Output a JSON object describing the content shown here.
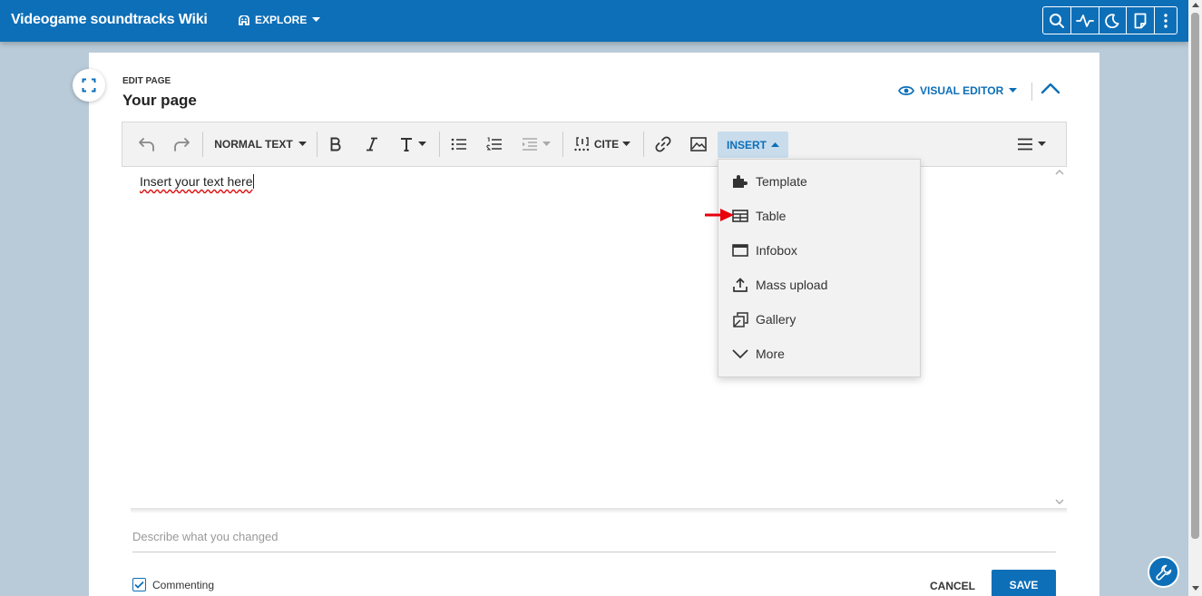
{
  "header": {
    "site_title": "Videogame soundtracks Wiki",
    "explore_label": "EXPLORE",
    "tools": [
      "search-icon",
      "activity-icon",
      "moon-icon",
      "discussion-icon",
      "more-icon"
    ]
  },
  "editor": {
    "edit_label": "EDIT PAGE",
    "page_title": "Your page",
    "mode_label": "VISUAL EDITOR",
    "content_text": "Insert your text here"
  },
  "toolbar": {
    "format_label": "NORMAL TEXT",
    "cite_label": "CITE",
    "insert_label": "INSERT"
  },
  "insert_menu": {
    "items": [
      {
        "label": "Template",
        "icon": "puzzle-icon"
      },
      {
        "label": "Table",
        "icon": "table-icon"
      },
      {
        "label": "Infobox",
        "icon": "infobox-icon"
      },
      {
        "label": "Mass upload",
        "icon": "upload-icon"
      },
      {
        "label": "Gallery",
        "icon": "gallery-icon"
      },
      {
        "label": "More",
        "icon": "chevron-down-icon"
      }
    ]
  },
  "footer": {
    "summary_placeholder": "Describe what you changed",
    "commenting_label": "Commenting",
    "commenting_checked": true,
    "cancel_label": "CANCEL",
    "save_label": "SAVE"
  },
  "colors": {
    "brand": "#0d6fb8",
    "background": "#b9cbd8",
    "insert_active": "#c8dcec",
    "annotation_arrow": "#e8000b"
  }
}
